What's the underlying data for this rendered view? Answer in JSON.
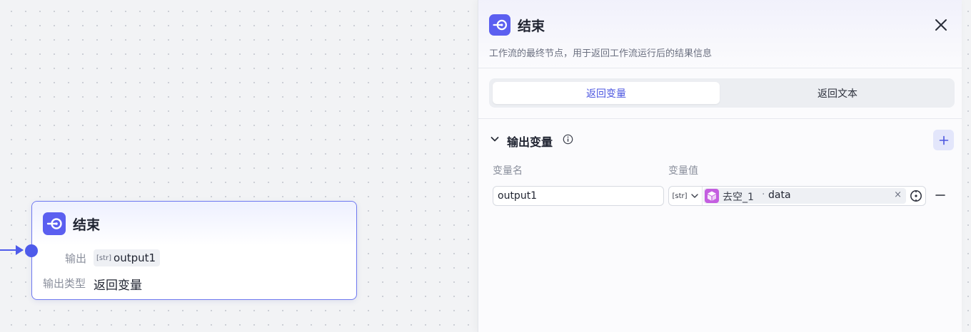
{
  "canvas": {
    "node": {
      "title": "结束",
      "output_label": "输出",
      "output_type_tag": "[str]",
      "output_var": "output1",
      "output_type_label": "输出类型",
      "output_type_value": "返回变量"
    }
  },
  "panel": {
    "title": "结束",
    "description": "工作流的最终节点，用于返回工作流运行后的结果信息",
    "tabs": [
      {
        "label": "返回变量",
        "active": true
      },
      {
        "label": "返回文本",
        "active": false
      }
    ],
    "section": {
      "title": "输出变量",
      "columns": {
        "name": "变量名",
        "value": "变量值"
      },
      "rows": [
        {
          "name": "output1",
          "type_tag": "[str]",
          "ref_node": "去空_1",
          "ref_separator": "·",
          "ref_var": "data",
          "clear_symbol": "×"
        }
      ]
    }
  },
  "colors": {
    "accent": "#5b5ff0",
    "edge": "#4e5bea",
    "ref_icon": "#c45ee0",
    "active_tab_text": "#4b55e0"
  },
  "icons": {
    "node_icon": "end-node-icon",
    "close": "close-icon",
    "chevron": "chevron-down-icon",
    "info": "info-icon",
    "add": "plus-icon",
    "ref_node": "cube-icon",
    "picker": "variable-picker-icon",
    "remove": "minus-icon"
  }
}
